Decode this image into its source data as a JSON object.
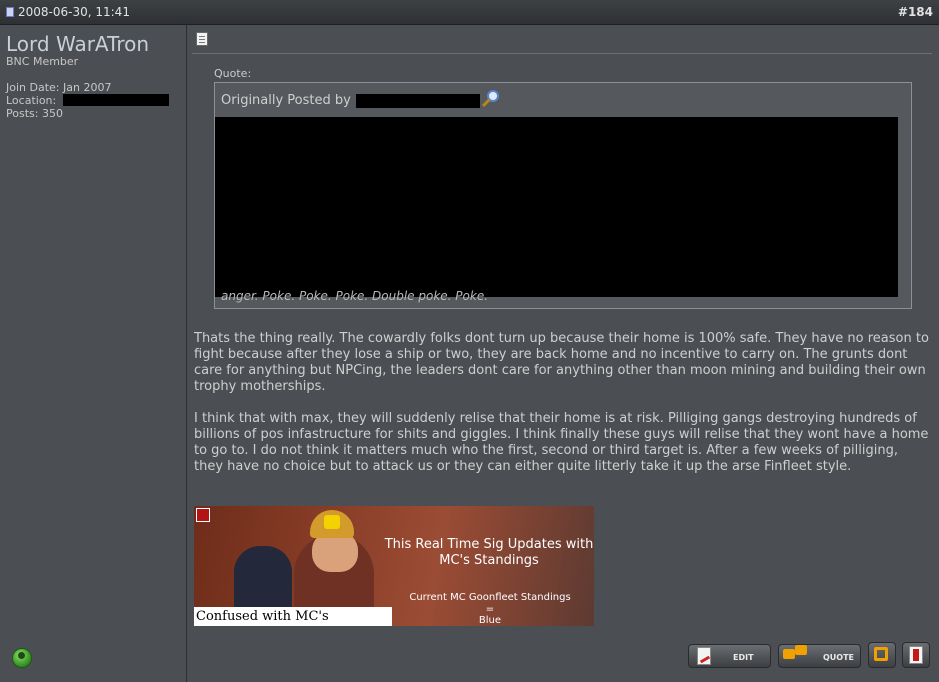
{
  "post": {
    "date": "2008-06-30, 11:41",
    "number": "#184"
  },
  "author": {
    "name": "Lord WarATron",
    "title": "BNC Member",
    "join_date": "Join Date: Jan 2007",
    "location_label": "Location:",
    "posts": "Posts: 350"
  },
  "quote": {
    "label": "Quote:",
    "originally_posted_by": "Originally Posted by",
    "tail_text": "anger. Poke. Poke. Poke. Double poke. Poke."
  },
  "body": {
    "paragraph1": "Thats the thing really. The cowardly folks dont turn up because their home is 100% safe. They have no reason to fight because after they lose a ship or two, they are back home and no incentive to carry on. The grunts dont care for anything but NPCing, the leaders dont care for anything other than moon mining and building their own trophy motherships.",
    "paragraph2": "I think that with max, they will suddenly relise that their home is at risk. Pilliging gangs destroying hundreds of billions of pos infastructure for shits and giggles. I think finally these guys will relise that they wont have a home to go to. I do not think it matters much who the first, second or third target is. After a few weeks of pilliging, they have no choice but to attack us or they can either quite litterly take it up the arse Finfleet style."
  },
  "signature": {
    "caption_line1": "This Real Time Sig Updates with",
    "caption_line2": "MC's Standings",
    "standings_label": "Current MC Goonfleet Standings",
    "equals": "=",
    "standing_value": "Blue",
    "confused_text": "Confused with MC's Standings?"
  },
  "buttons": {
    "edit": "EDIT",
    "quote": "QUOTE"
  }
}
